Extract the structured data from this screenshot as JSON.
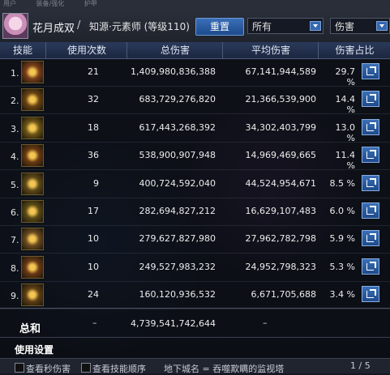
{
  "topstrip": [
    "用户",
    "装备/强化",
    "护甲"
  ],
  "header": {
    "name": "花月成双",
    "separator": "/",
    "class": "知源·元素师 (等级110)",
    "reset": "重置",
    "filter1": "所有",
    "filter2": "伤害"
  },
  "columns": [
    "技能",
    "使用次数",
    "总伤害",
    "平均伤害",
    "伤害占比"
  ],
  "rows": [
    {
      "rank": "1.",
      "uses": "21",
      "total": "1,409,980,836,388",
      "avg": "67,141,944,589",
      "pct": "29.7 %",
      "icon": "vortex-skill-icon"
    },
    {
      "rank": "2.",
      "uses": "32",
      "total": "683,729,276,820",
      "avg": "21,366,539,900",
      "pct": "14.4 %",
      "icon": "flame-burst-skill-icon"
    },
    {
      "rank": "3.",
      "uses": "18",
      "total": "617,443,268,392",
      "avg": "34,302,403,799",
      "pct": "13.0 %",
      "icon": "starburst-skill-icon"
    },
    {
      "rank": "4.",
      "uses": "36",
      "total": "538,900,907,948",
      "avg": "14,969,469,665",
      "pct": "11.4 %",
      "icon": "blaze-skill-icon"
    },
    {
      "rank": "5.",
      "uses": "9",
      "total": "400,724,592,040",
      "avg": "44,524,954,671",
      "pct": "8.5 %",
      "icon": "lightning-skill-icon"
    },
    {
      "rank": "6.",
      "uses": "17",
      "total": "282,694,827,212",
      "avg": "16,629,107,483",
      "pct": "6.0 %",
      "icon": "pillars-skill-icon"
    },
    {
      "rank": "7.",
      "uses": "10",
      "total": "279,627,827,980",
      "avg": "27,962,782,798",
      "pct": "5.9 %",
      "icon": "ripple-skill-icon"
    },
    {
      "rank": "8.",
      "uses": "10",
      "total": "249,527,983,232",
      "avg": "24,952,798,323",
      "pct": "5.3 %",
      "icon": "meteor-skill-icon"
    },
    {
      "rank": "9.",
      "uses": "24",
      "total": "160,120,936,532",
      "avg": "6,671,705,688",
      "pct": "3.4 %",
      "icon": "gate-skill-icon"
    }
  ],
  "summary": {
    "label": "总和",
    "uses": "–",
    "total": "4,739,541,742,644",
    "avg": "–"
  },
  "settings_label": "使用设置",
  "footer": {
    "opt1": "查看秒伤害",
    "opt2": "查看技能顺序",
    "dungeon": "地下城名 = 吞噬欺瞒的监视塔",
    "pager": "1 / 5"
  }
}
